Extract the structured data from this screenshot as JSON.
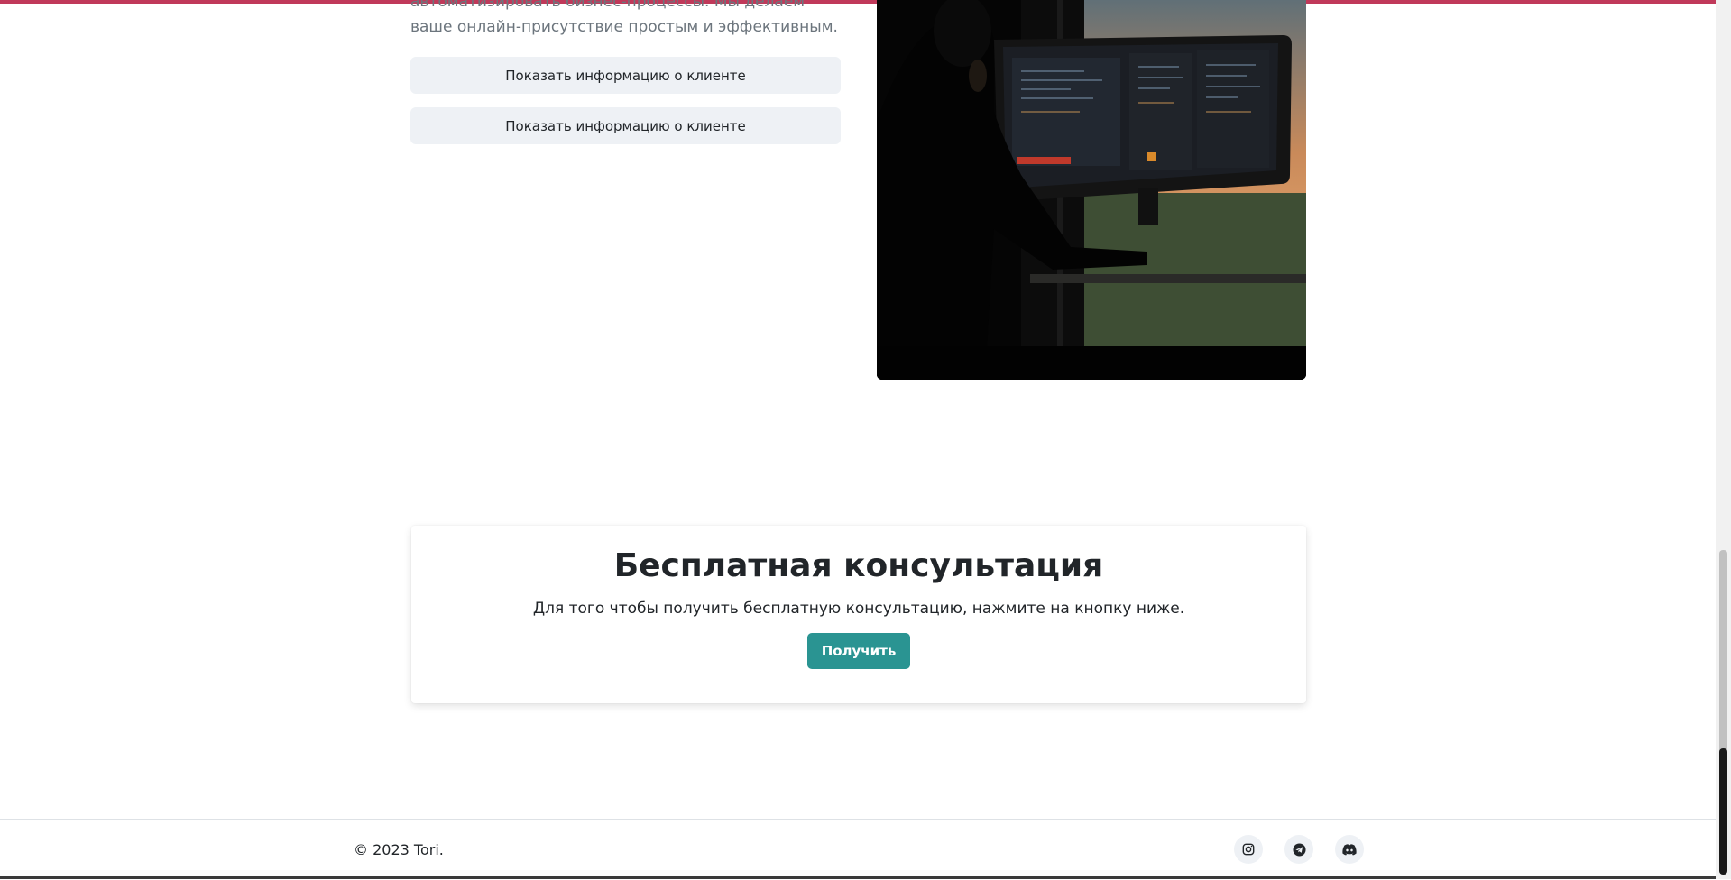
{
  "intro": {
    "text": "автоматизировать бизнес-процессы. Мы делаем ваше онлайн-присутствие простым и эффективным."
  },
  "clients": {
    "buttons": [
      {
        "label": "Показать информацию о клиенте"
      },
      {
        "label": "Показать информацию о клиенте"
      }
    ]
  },
  "consultation": {
    "title": "Бесплатная консультация",
    "description": "Для того чтобы получить бесплатную консультацию, нажмите на кнопку ниже.",
    "button_label": "Получить"
  },
  "footer": {
    "copyright": "© 2023 Tori.",
    "social": [
      {
        "icon": "instagram-icon"
      },
      {
        "icon": "telegram-icon"
      },
      {
        "icon": "discord-icon"
      }
    ]
  },
  "colors": {
    "accent": "#2a9492",
    "top_bar": "#c0395a",
    "button_bg": "#eef1f5"
  }
}
